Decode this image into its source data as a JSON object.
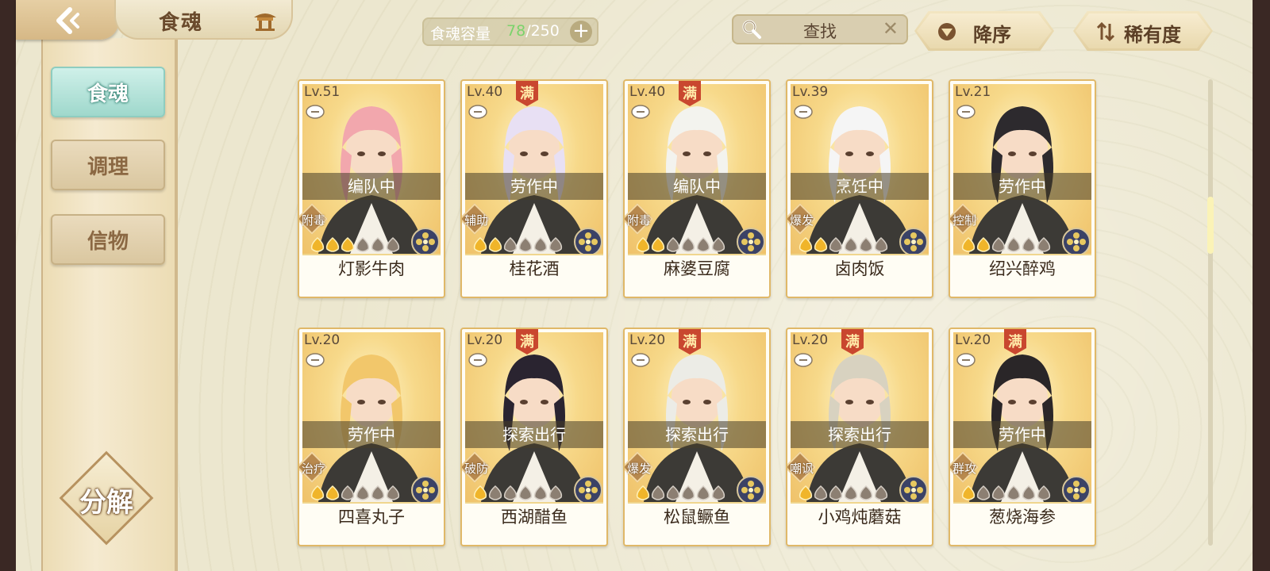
{
  "header": {
    "title": "食魂",
    "capacity_label": "食魂容量",
    "capacity_current": "78",
    "capacity_total": "/250",
    "capacity_add": "+",
    "search_placeholder": "查找",
    "search_clear": "✕",
    "sort_order_label": "降序",
    "sort_key_label": "稀有度"
  },
  "sidebar": {
    "items": [
      {
        "label": "食魂",
        "active": true
      },
      {
        "label": "调理",
        "active": false
      },
      {
        "label": "信物",
        "active": false
      }
    ],
    "decompose_label": "分解"
  },
  "colors": {
    "capacity_current": "#7bd36b",
    "active_tab": "#9fd8cc",
    "card_border": "#e0b868"
  },
  "cards": [
    {
      "level": "Lv.51",
      "full": false,
      "status": "编队中",
      "role": "附毒",
      "name": "灯影牛肉",
      "flames_lit": 3,
      "flames_total": 6,
      "hair": "#f2a7ad"
    },
    {
      "level": "Lv.40",
      "full": true,
      "full_label": "满",
      "status": "劳作中",
      "role": "辅助",
      "name": "桂花酒",
      "flames_lit": 2,
      "flames_total": 6,
      "hair": "#e8e0f4"
    },
    {
      "level": "Lv.40",
      "full": true,
      "full_label": "满",
      "status": "编队中",
      "role": "附毒",
      "name": "麻婆豆腐",
      "flames_lit": 2,
      "flames_total": 6,
      "hair": "#f3f3ee"
    },
    {
      "level": "Lv.39",
      "full": false,
      "status": "烹饪中",
      "role": "爆发",
      "name": "卤肉饭",
      "flames_lit": 2,
      "flames_total": 6,
      "hair": "#f5f5f5"
    },
    {
      "level": "Lv.21",
      "full": false,
      "status": "劳作中",
      "role": "控制",
      "name": "绍兴醉鸡",
      "flames_lit": 2,
      "flames_total": 6,
      "hair": "#2d2a2e"
    },
    {
      "level": "Lv.20",
      "full": false,
      "status": "劳作中",
      "role": "治疗",
      "name": "四喜丸子",
      "flames_lit": 2,
      "flames_total": 6,
      "hair": "#f2c76b"
    },
    {
      "level": "Lv.20",
      "full": true,
      "full_label": "满",
      "status": "探索出行",
      "role": "破防",
      "name": "西湖醋鱼",
      "flames_lit": 1,
      "flames_total": 6,
      "hair": "#2a2430"
    },
    {
      "level": "Lv.20",
      "full": true,
      "full_label": "满",
      "status": "探索出行",
      "role": "爆发",
      "name": "松鼠鳜鱼",
      "flames_lit": 1,
      "flames_total": 6,
      "hair": "#ecece6"
    },
    {
      "level": "Lv.20",
      "full": true,
      "full_label": "满",
      "status": "探索出行",
      "role": "嘲讽",
      "name": "小鸡炖蘑菇",
      "flames_lit": 1,
      "flames_total": 6,
      "hair": "#d8d2c0"
    },
    {
      "level": "Lv.20",
      "full": true,
      "full_label": "满",
      "status": "劳作中",
      "role": "群攻",
      "name": "葱烧海参",
      "flames_lit": 1,
      "flames_total": 6,
      "hair": "#2a2628"
    }
  ]
}
